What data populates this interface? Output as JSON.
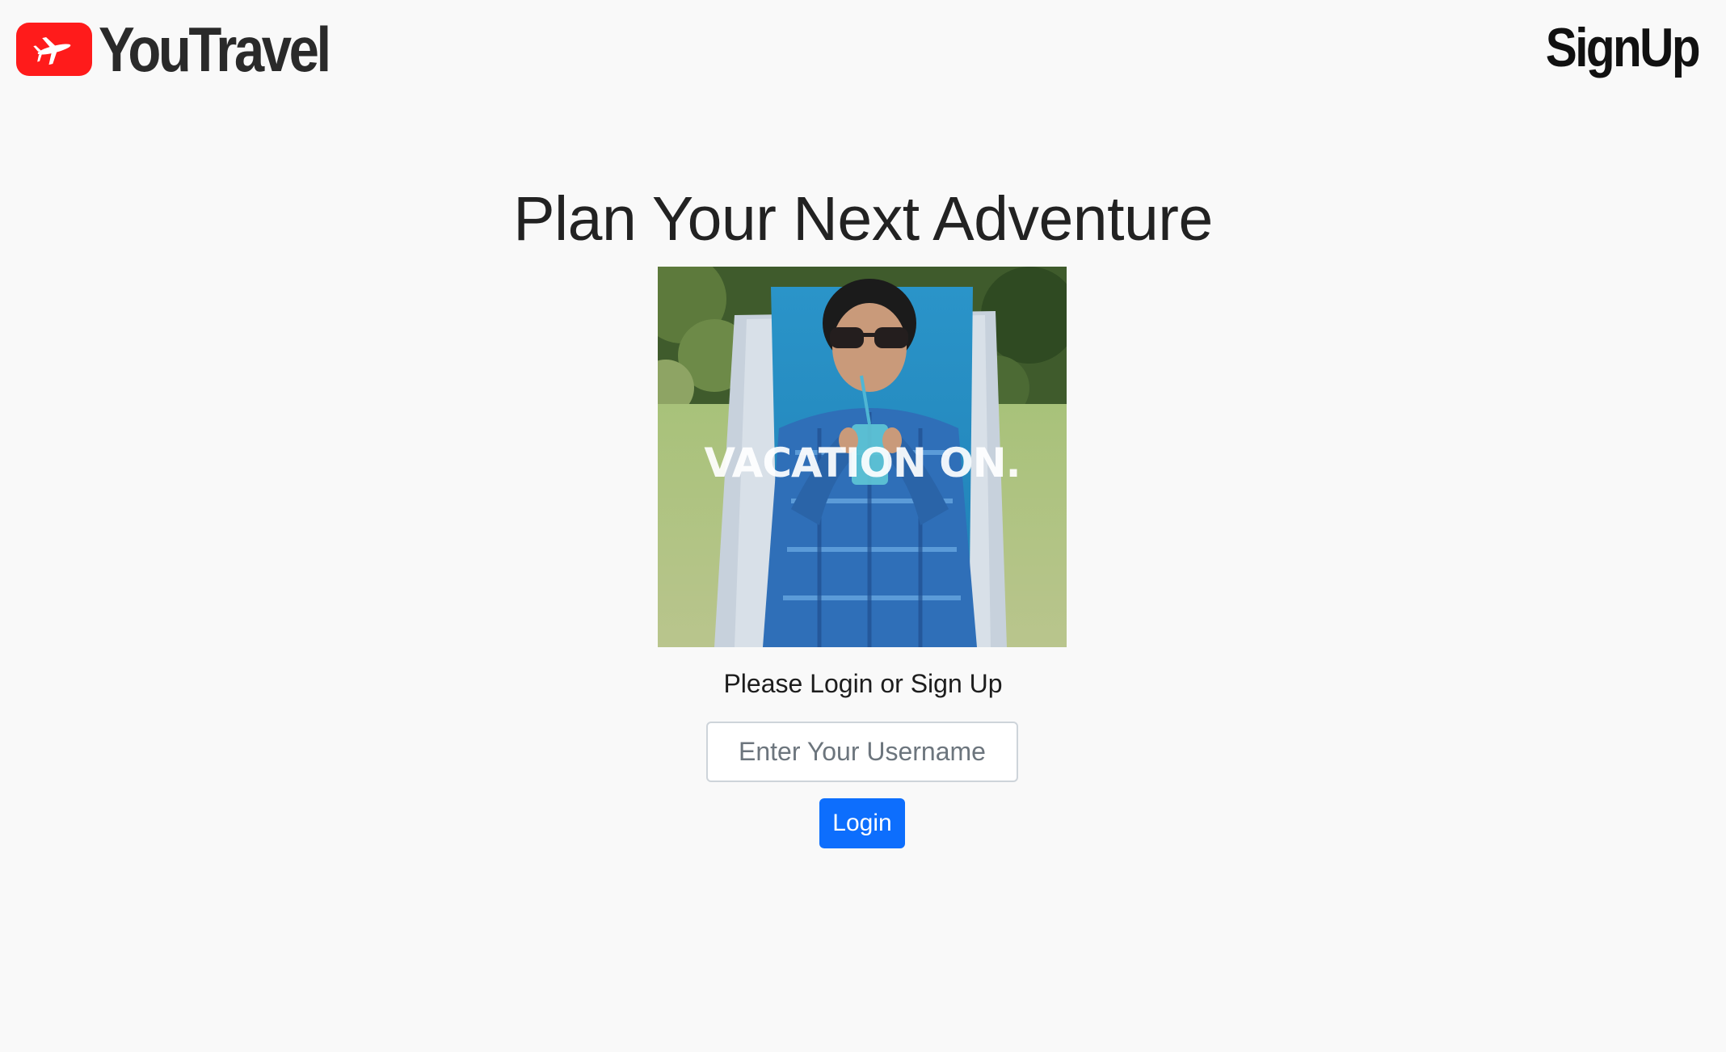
{
  "header": {
    "brand_name": "YouTravel",
    "brand_icon": "airplane-icon",
    "brand_color": "#ff1b1b",
    "signup_label": "SignUp"
  },
  "main": {
    "title": "Plan Your Next Adventure",
    "hero_caption": "VACATION ON.",
    "prompt": "Please Login or Sign Up",
    "username_placeholder": "Enter Your Username",
    "username_value": "",
    "login_label": "Login",
    "login_color": "#0d6efd"
  }
}
